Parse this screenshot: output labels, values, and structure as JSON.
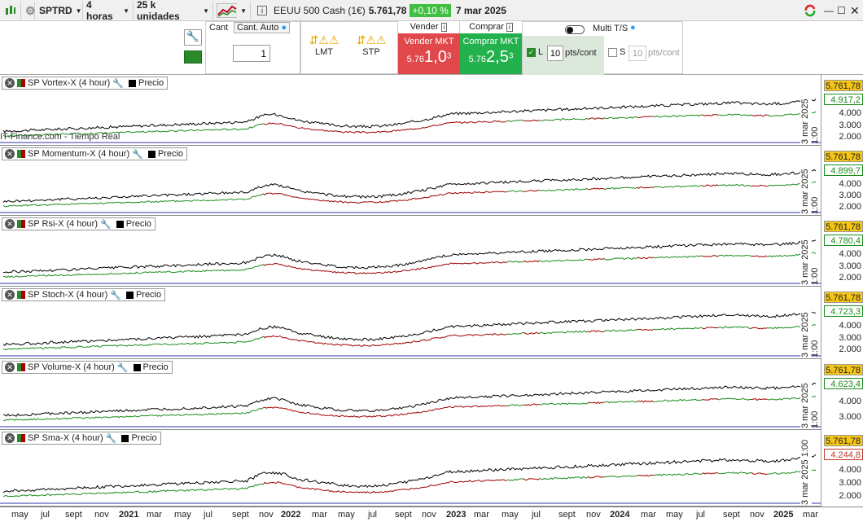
{
  "toolbar": {
    "symbol": "SPTRD",
    "timeframe": "4 horas",
    "units": "25 k unidades",
    "instrument": "EEUU 500 Cash (1€)",
    "price": "5.761,78",
    "change": "+0,10 %",
    "date": "7 mar 2025"
  },
  "order_panel": {
    "qty_label": "Cant",
    "qty_auto_label": "Cant. Auto",
    "qty_value": "1",
    "lmt_label": "LMT",
    "stp_label": "STP",
    "sell_header": "Vender",
    "buy_header": "Comprar",
    "sell_mkt": "Vender MKT",
    "buy_mkt": "Comprar MKT",
    "sell_price_prefix": "5.76",
    "sell_price_main": "1,0",
    "sell_price_sup": "3",
    "buy_price_prefix": "5.76",
    "buy_price_main": "2,5",
    "buy_price_sup": "3",
    "multi_ts": "Multi T/S",
    "l_label": "L",
    "l_value": "10",
    "l_unit": "pts/cont",
    "s_label": "S",
    "s_value": "10",
    "s_unit": "pts/cont"
  },
  "panes": [
    {
      "name": "SP  Vortex-X (4 hour)",
      "price_label": "Precio",
      "price_tag": "5.761,78",
      "ind_tag": "4.917,2",
      "ind_color": "#1a8c1a",
      "ticks": [
        "5.000",
        "4.000",
        "3.000",
        "2.000"
      ],
      "date_label": "3 mar 2025 1:00",
      "watermark": "IT-Finance.com - Tiempo Real"
    },
    {
      "name": "SP Momentum-X (4 hour)",
      "price_label": "Precio",
      "price_tag": "5.761,78",
      "ind_tag": "4.899,7",
      "ind_color": "#1a8c1a",
      "ticks": [
        "5.000",
        "4.000",
        "3.000",
        "2.000"
      ],
      "date_label": "3 mar 2025 1:00",
      "watermark": ""
    },
    {
      "name": "SP Rsi-X (4 hour)",
      "price_label": "Precio",
      "price_tag": "5.761,78",
      "ind_tag": "4.780,4",
      "ind_color": "#1a8c1a",
      "ticks": [
        "5.000",
        "4.000",
        "3.000",
        "2.000"
      ],
      "date_label": "3 mar 2025 1:00",
      "watermark": ""
    },
    {
      "name": "SP Stoch-X (4 hour)",
      "price_label": "Precio",
      "price_tag": "5.761,78",
      "ind_tag": "4.723,3",
      "ind_color": "#1a8c1a",
      "ticks": [
        "5.000",
        "4.000",
        "3.000",
        "2.000"
      ],
      "date_label": "3 mar 2025 1:00",
      "watermark": ""
    },
    {
      "name": "SP Volume-X (4 hour)",
      "price_label": "Precio",
      "price_tag": "5.761,78",
      "ind_tag": "4.623,4",
      "ind_color": "#1a8c1a",
      "ticks": [
        "5.000",
        "4.000",
        "3.000"
      ],
      "date_label": "3 mar 2025 1:00",
      "watermark": ""
    },
    {
      "name": "SP Sma-X (4 hour)",
      "price_label": "Precio",
      "price_tag": "5.761,78",
      "ind_tag": "4.244,8",
      "ind_color": "#c0392b",
      "ticks": [
        "5.000",
        "4.000",
        "3.000",
        "2.000"
      ],
      "date_label": "3 mar 2025 1:00",
      "watermark": ""
    }
  ],
  "xaxis": [
    "may",
    "jul",
    "sept",
    "nov",
    "2021",
    "mar",
    "may",
    "jul",
    "sept",
    "nov",
    "2022",
    "mar",
    "may",
    "jul",
    "sept",
    "nov",
    "2023",
    "mar",
    "may",
    "jul",
    "sept",
    "nov",
    "2024",
    "mar",
    "may",
    "jul",
    "sept",
    "nov",
    "2025",
    "mar"
  ],
  "colors": {
    "sell": "#e0484b",
    "buy": "#22b14c",
    "price_line": "#000000",
    "ind_up": "#1a8c1a",
    "ind_down": "#a00000",
    "tag_bg": "#f5c518"
  }
}
